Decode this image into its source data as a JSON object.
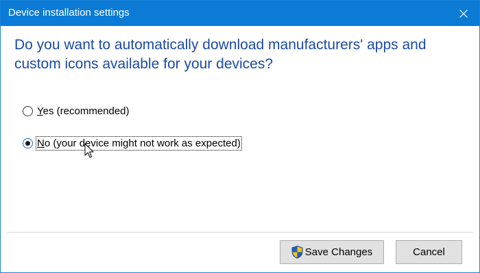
{
  "window": {
    "title": "Device installation settings"
  },
  "question": "Do you want to automatically download manufacturers' apps and custom icons available for your devices?",
  "options": [
    {
      "accel": "Y",
      "rest": "es (recommended)",
      "selected": false
    },
    {
      "accel": "N",
      "rest": "o (your device might not work as expected)",
      "selected": true
    }
  ],
  "buttons": {
    "save_label": "Save Changes",
    "cancel_label": "Cancel"
  },
  "icons": {
    "close": "close-icon",
    "save": "uac-shield-icon",
    "cursor": "mouse-pointer-icon"
  },
  "colors": {
    "titlebar": "#0b7bd6",
    "question_text": "#1b4aa8",
    "button_bg": "#e1e1e1"
  }
}
